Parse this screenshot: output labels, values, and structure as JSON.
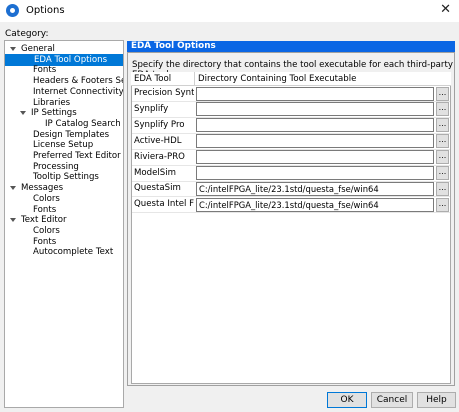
{
  "window": {
    "title": "Options"
  },
  "category_label": "Category:",
  "tree": [
    {
      "label": "General",
      "expander": true,
      "indent": 0
    },
    {
      "label": "EDA Tool Options",
      "selected": true,
      "indent": 2
    },
    {
      "label": "Fonts",
      "indent": 2
    },
    {
      "label": "Headers & Footers Settir",
      "indent": 2
    },
    {
      "label": "Internet Connectivity",
      "indent": 2
    },
    {
      "label": "Libraries",
      "indent": 2
    },
    {
      "label": "IP Settings",
      "expander": true,
      "indent": 1
    },
    {
      "label": "IP Catalog Search Loc",
      "indent": 3
    },
    {
      "label": "Design Templates",
      "indent": 2
    },
    {
      "label": "License Setup",
      "indent": 2
    },
    {
      "label": "Preferred Text Editor",
      "indent": 2
    },
    {
      "label": "Processing",
      "indent": 2
    },
    {
      "label": "Tooltip Settings",
      "indent": 2
    },
    {
      "label": "Messages",
      "expander": true,
      "indent": 0
    },
    {
      "label": "Colors",
      "indent": 2
    },
    {
      "label": "Fonts",
      "indent": 2
    },
    {
      "label": "Text Editor",
      "expander": true,
      "indent": 0
    },
    {
      "label": "Colors",
      "indent": 2
    },
    {
      "label": "Fonts",
      "indent": 2
    },
    {
      "label": "Autocomplete Text",
      "indent": 2
    }
  ],
  "panel": {
    "title": "EDA Tool Options",
    "description": "Specify the directory that contains the tool executable for each third-party EDA tool:",
    "columns": [
      "EDA Tool",
      "Directory Containing Tool Executable"
    ],
    "rows": [
      {
        "tool": "Precision Synth...",
        "path": ""
      },
      {
        "tool": "Synplify",
        "path": ""
      },
      {
        "tool": "Synplify Pro",
        "path": ""
      },
      {
        "tool": "Active-HDL",
        "path": ""
      },
      {
        "tool": "Riviera-PRO",
        "path": ""
      },
      {
        "tool": "ModelSim",
        "path": ""
      },
      {
        "tool": "QuestaSim",
        "path": "C:/intelFPGA_lite/23.1std/questa_fse/win64"
      },
      {
        "tool": "Questa Intel FP...",
        "path": "C:/intelFPGA_lite/23.1std/questa_fse/win64"
      }
    ],
    "browse_label": "..."
  },
  "buttons": {
    "ok": "OK",
    "cancel": "Cancel",
    "help": "Help"
  },
  "colors": {
    "accent": "#0078d7",
    "panel_header": "#0a66e4"
  }
}
